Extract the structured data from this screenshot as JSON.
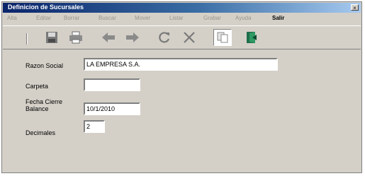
{
  "window": {
    "title": "Definicion de Sucursales",
    "close_glyph": "×"
  },
  "menu": [
    "Alta",
    "Editar",
    "Borrar",
    "Buscar",
    "Mover",
    "Listar",
    "Grabar",
    "Ayuda",
    "Salir"
  ],
  "toolbar_icons": [
    "save-icon",
    "print-icon",
    "back-arrow-icon",
    "forward-arrow-icon",
    "refresh-icon",
    "delete-icon",
    "copy-icon",
    "exit-icon"
  ],
  "form": {
    "razon_social": {
      "label": "Razon Social",
      "value": "LA EMPRESA S.A."
    },
    "carpeta": {
      "label": "Carpeta",
      "value": ""
    },
    "fecha_cierre": {
      "label": "Fecha Cierre\nBalance",
      "value": "10/1/2010"
    },
    "decimales": {
      "label": "Decimales",
      "value": "2"
    }
  },
  "colors": {
    "title_start": "#0a246a",
    "title_end": "#a6caf0",
    "face": "#d4d0c8"
  }
}
